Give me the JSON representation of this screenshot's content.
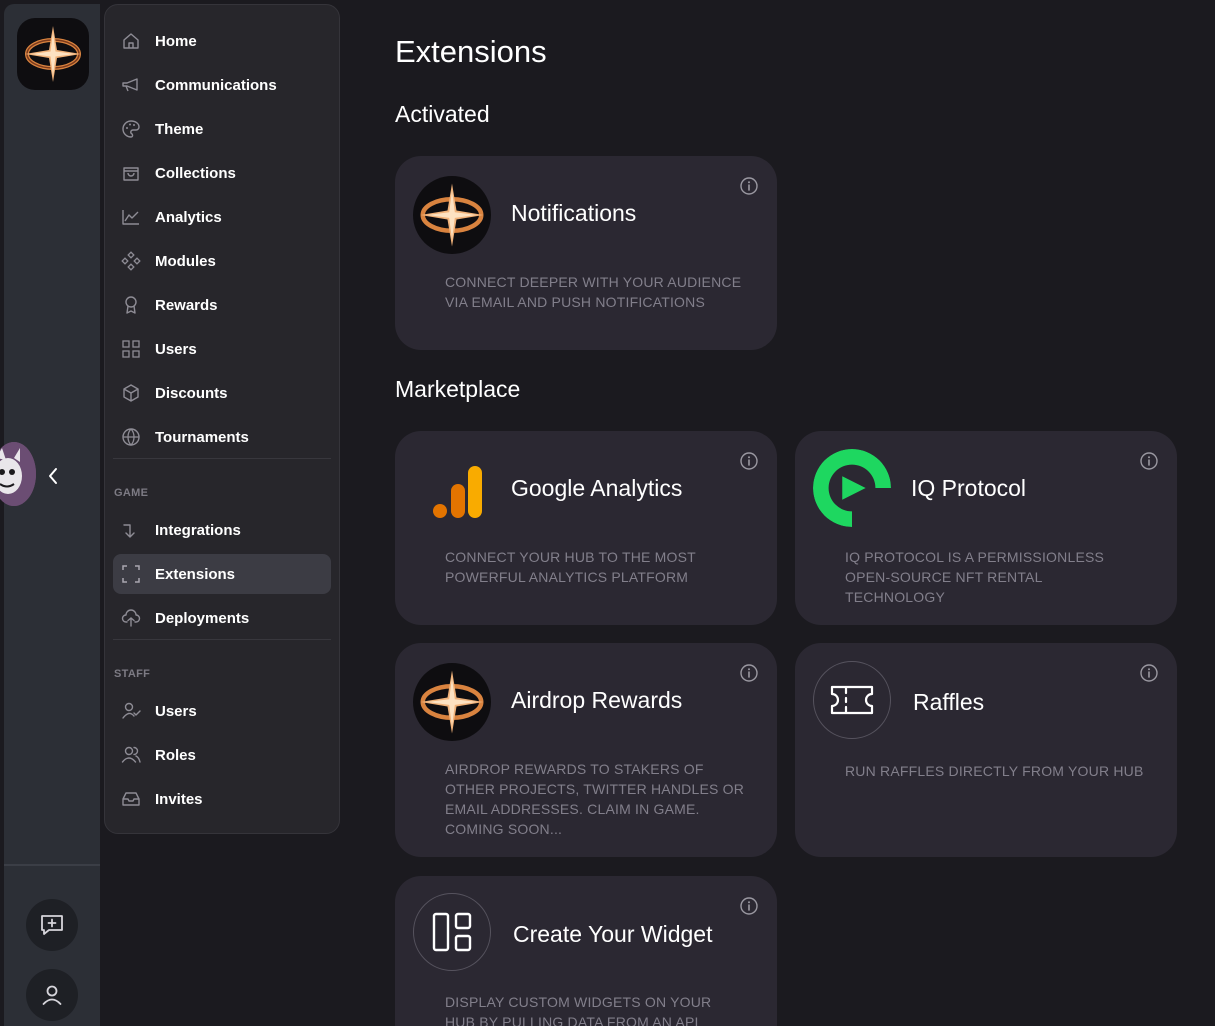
{
  "nav": {
    "items": [
      {
        "label": "Home",
        "icon": "home-icon"
      },
      {
        "label": "Communications",
        "icon": "megaphone-icon"
      },
      {
        "label": "Theme",
        "icon": "palette-icon"
      },
      {
        "label": "Collections",
        "icon": "bag-icon"
      },
      {
        "label": "Analytics",
        "icon": "chart-icon"
      },
      {
        "label": "Modules",
        "icon": "modules-icon"
      },
      {
        "label": "Rewards",
        "icon": "award-icon"
      },
      {
        "label": "Users",
        "icon": "grid-icon"
      },
      {
        "label": "Discounts",
        "icon": "box-icon"
      },
      {
        "label": "Tournaments",
        "icon": "globe-icon"
      }
    ],
    "game_section": "GAME",
    "game_items": [
      {
        "label": "Integrations",
        "icon": "arrow-down-right-icon"
      },
      {
        "label": "Extensions",
        "icon": "extensions-icon",
        "active": true
      },
      {
        "label": "Deployments",
        "icon": "cloud-upload-icon"
      }
    ],
    "staff_section": "STAFF",
    "staff_items": [
      {
        "label": "Users",
        "icon": "user-check-icon"
      },
      {
        "label": "Roles",
        "icon": "users-icon"
      },
      {
        "label": "Invites",
        "icon": "inbox-icon"
      }
    ]
  },
  "main": {
    "title": "Extensions",
    "activated_heading": "Activated",
    "marketplace_heading": "Marketplace",
    "cards": {
      "notifications": {
        "title": "Notifications",
        "description": "CONNECT DEEPER WITH YOUR AUDIENCE VIA EMAIL AND PUSH NOTIFICATIONS"
      },
      "google_analytics": {
        "title": "Google Analytics",
        "description": "CONNECT YOUR HUB TO THE MOST POWERFUL ANALYTICS PLATFORM"
      },
      "iq_protocol": {
        "title": "IQ Protocol",
        "description": "IQ PROTOCOL IS A PERMISSIONLESS OPEN-SOURCE NFT RENTAL TECHNOLOGY"
      },
      "airdrop_rewards": {
        "title": "Airdrop Rewards",
        "description": "AIRDROP REWARDS TO STAKERS OF OTHER PROJECTS, TWITTER HANDLES OR EMAIL ADDRESSES. CLAIM IN GAME. COMING SOON..."
      },
      "raffles": {
        "title": "Raffles",
        "description": "RUN RAFFLES DIRECTLY FROM YOUR HUB"
      },
      "create_widget": {
        "title": "Create Your Widget",
        "description": "DISPLAY CUSTOM WIDGETS ON YOUR HUB BY PULLING DATA FROM AN API"
      }
    }
  },
  "colors": {
    "background": "#1b1a1f",
    "card": "#2b2832",
    "accent_green": "#1ed760",
    "analytics_orange": "#f9ab00",
    "analytics_dark_orange": "#e37400"
  }
}
